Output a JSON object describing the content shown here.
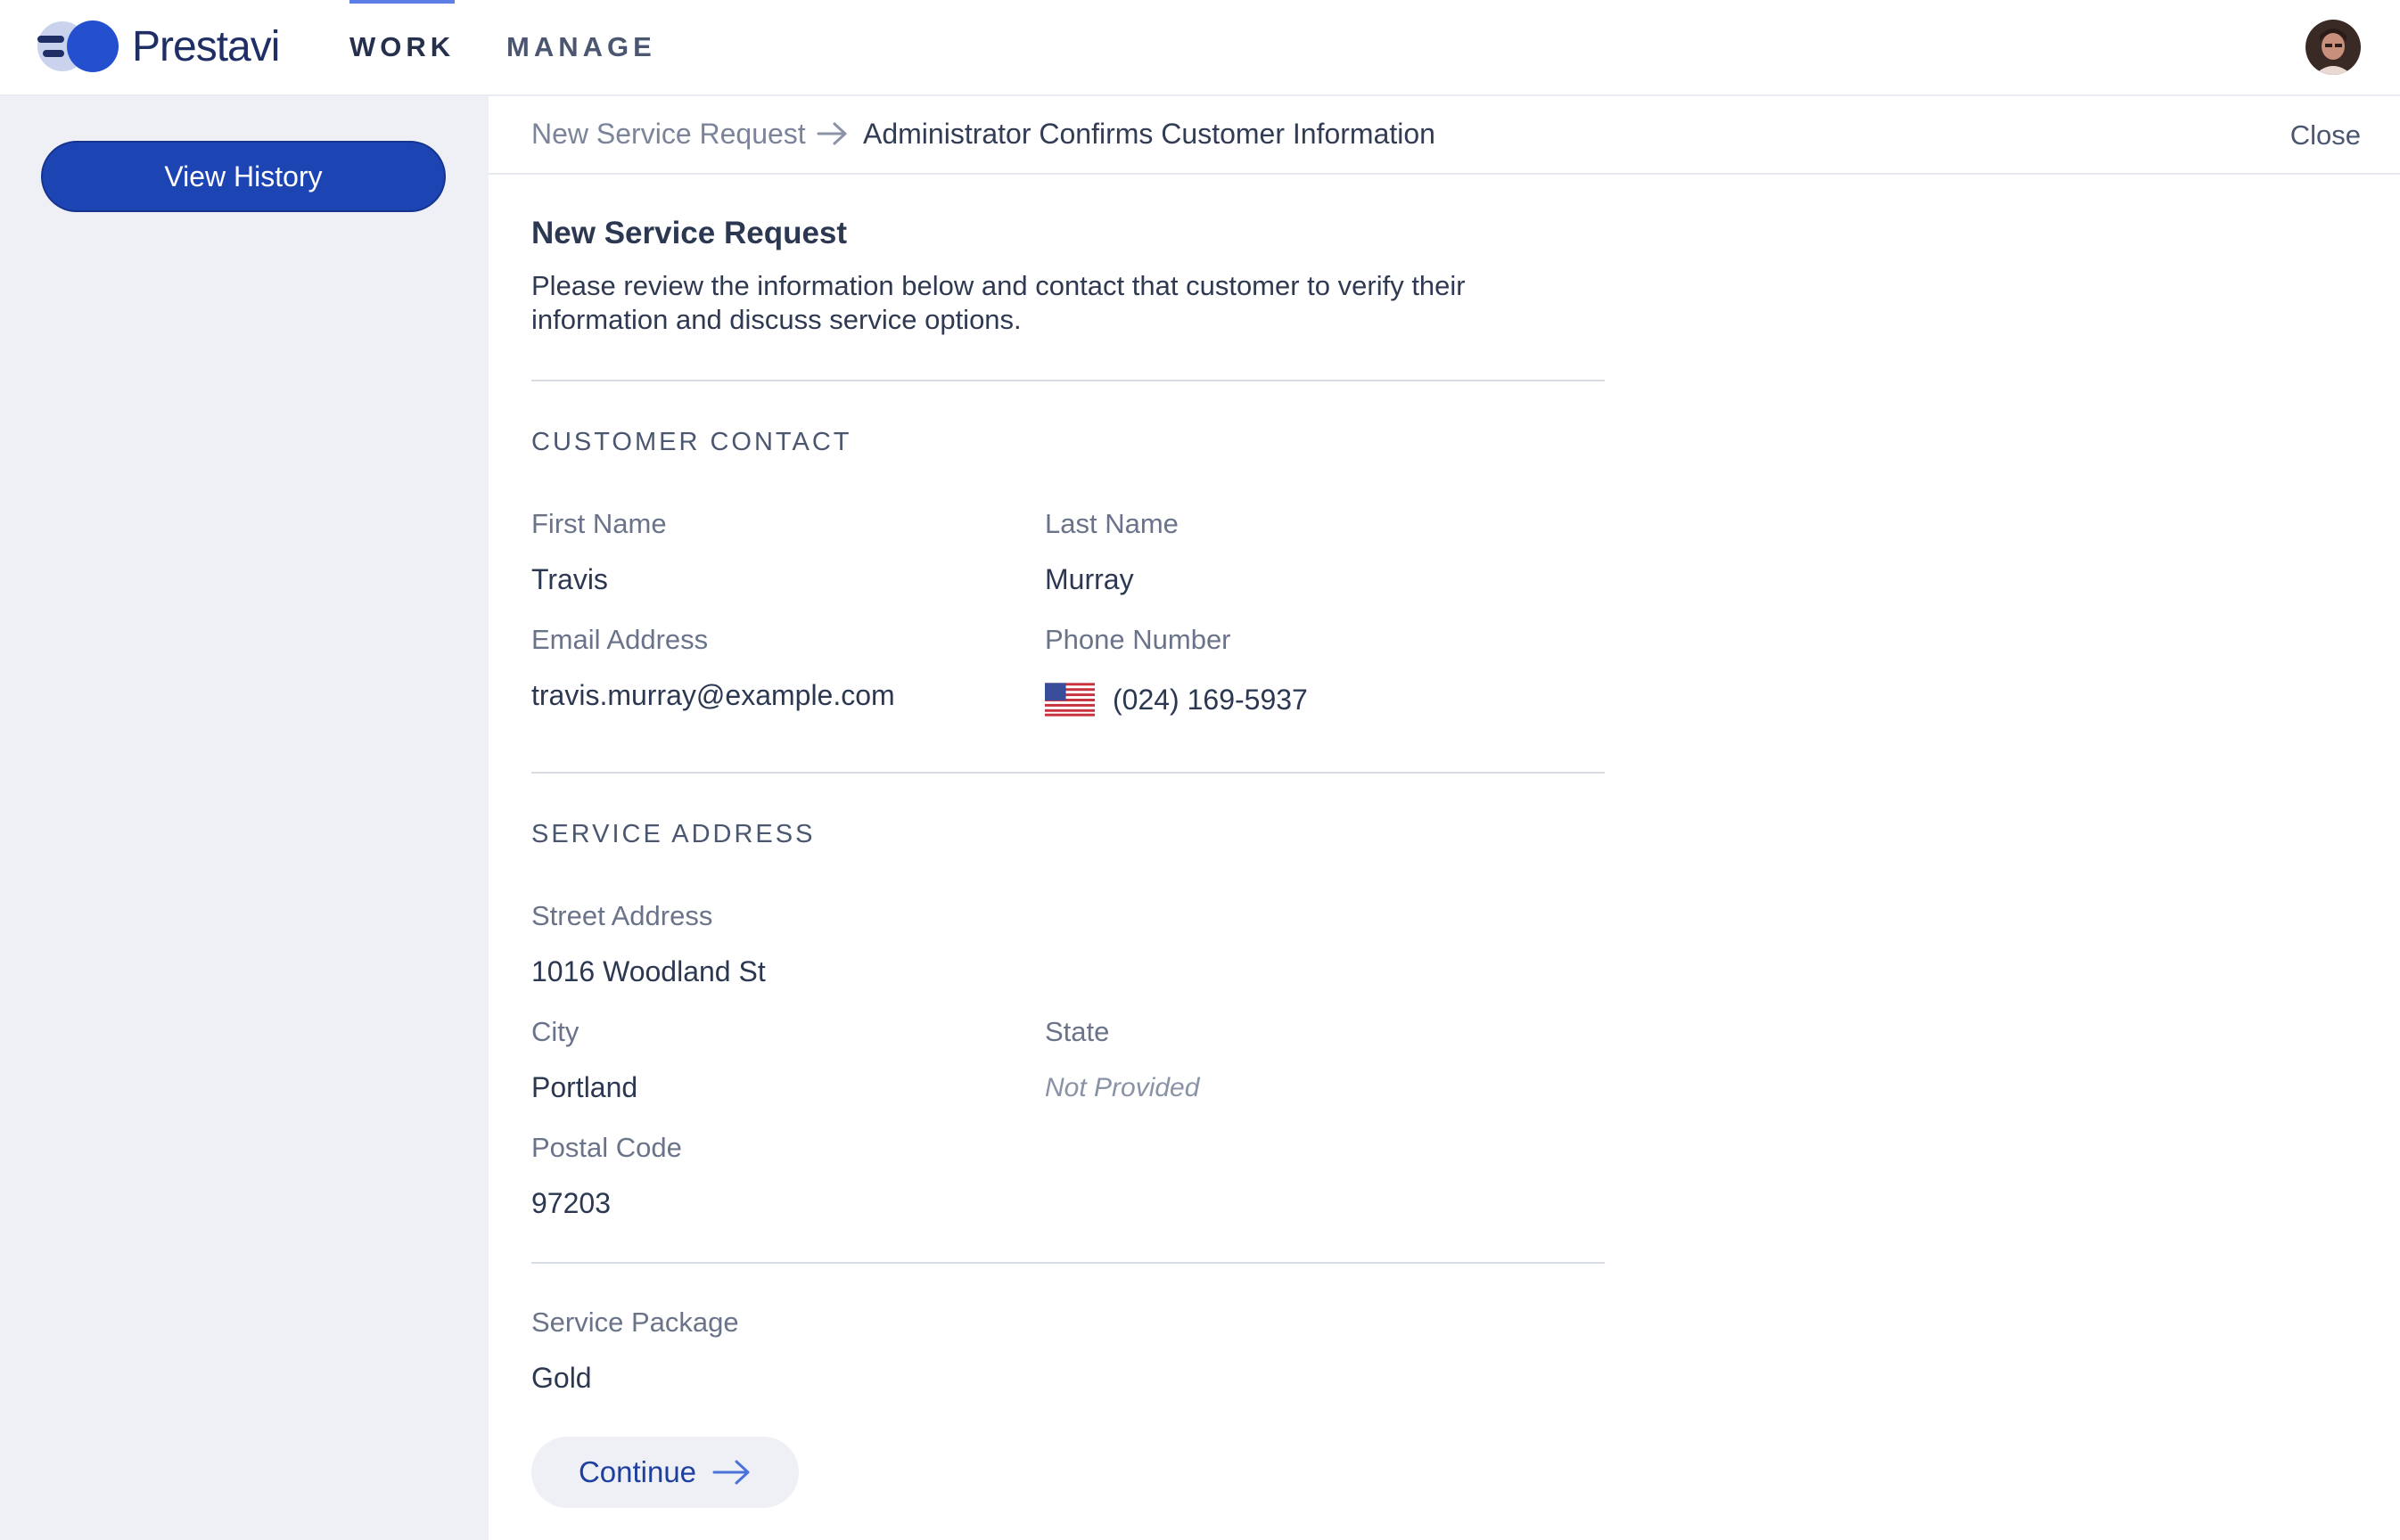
{
  "brand": {
    "name": "Prestavi"
  },
  "nav": {
    "tabs": [
      {
        "label": "WORK",
        "active": true
      },
      {
        "label": "MANAGE",
        "active": false
      }
    ]
  },
  "sidebar": {
    "view_history_label": "View History"
  },
  "breadcrumb": {
    "previous": "New Service Request",
    "current": "Administrator Confirms Customer Information",
    "close_label": "Close"
  },
  "main": {
    "title": "New Service Request",
    "description": "Please review the information below and contact that customer to verify their information and discuss service options.",
    "customer_contact": {
      "heading": "CUSTOMER CONTACT",
      "first_name": {
        "label": "First Name",
        "value": "Travis"
      },
      "last_name": {
        "label": "Last Name",
        "value": "Murray"
      },
      "email": {
        "label": "Email Address",
        "value": "travis.murray@example.com"
      },
      "phone": {
        "label": "Phone Number",
        "value": "(024) 169-5937",
        "flag_icon": "us-flag-icon"
      }
    },
    "service_address": {
      "heading": "SERVICE ADDRESS",
      "street": {
        "label": "Street Address",
        "value": "1016 Woodland St"
      },
      "city": {
        "label": "City",
        "value": "Portland"
      },
      "state": {
        "label": "State",
        "value": "Not Provided"
      },
      "postal_code": {
        "label": "Postal Code",
        "value": "97203"
      }
    },
    "service_package": {
      "label": "Service Package",
      "value": "Gold"
    },
    "continue_label": "Continue"
  },
  "colors": {
    "brand_blue": "#1d44b3",
    "accent_tab": "#5b7fe6",
    "sidebar_bg": "#eef0f5",
    "text_primary": "#2c3852",
    "text_muted": "#6a7389"
  }
}
